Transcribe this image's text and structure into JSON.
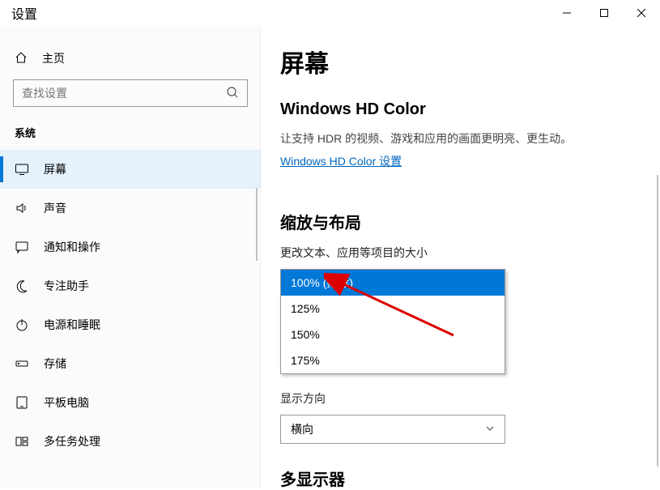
{
  "window": {
    "title": "设置"
  },
  "sidebar": {
    "home": "主页",
    "search_placeholder": "查找设置",
    "section": "系统",
    "items": [
      {
        "label": "屏幕",
        "icon": "monitor",
        "selected": true
      },
      {
        "label": "声音",
        "icon": "speaker",
        "selected": false
      },
      {
        "label": "通知和操作",
        "icon": "message",
        "selected": false
      },
      {
        "label": "专注助手",
        "icon": "moon",
        "selected": false
      },
      {
        "label": "电源和睡眠",
        "icon": "power",
        "selected": false
      },
      {
        "label": "存储",
        "icon": "storage",
        "selected": false
      },
      {
        "label": "平板电脑",
        "icon": "tablet",
        "selected": false
      },
      {
        "label": "多任务处理",
        "icon": "multitask",
        "selected": false
      }
    ]
  },
  "content": {
    "page_title": "屏幕",
    "hdcolor": {
      "heading": "Windows HD Color",
      "description": "让支持 HDR 的视频、游戏和应用的画面更明亮、更生动。",
      "link": "Windows HD Color 设置"
    },
    "scale": {
      "heading": "缩放与布局",
      "size_label": "更改文本、应用等项目的大小",
      "options": [
        "100% (推荐)",
        "125%",
        "150%",
        "175%"
      ],
      "selected_index": 0
    },
    "orientation": {
      "label": "显示方向",
      "value": "横向"
    },
    "multidisplay": {
      "heading": "多显示器"
    }
  }
}
